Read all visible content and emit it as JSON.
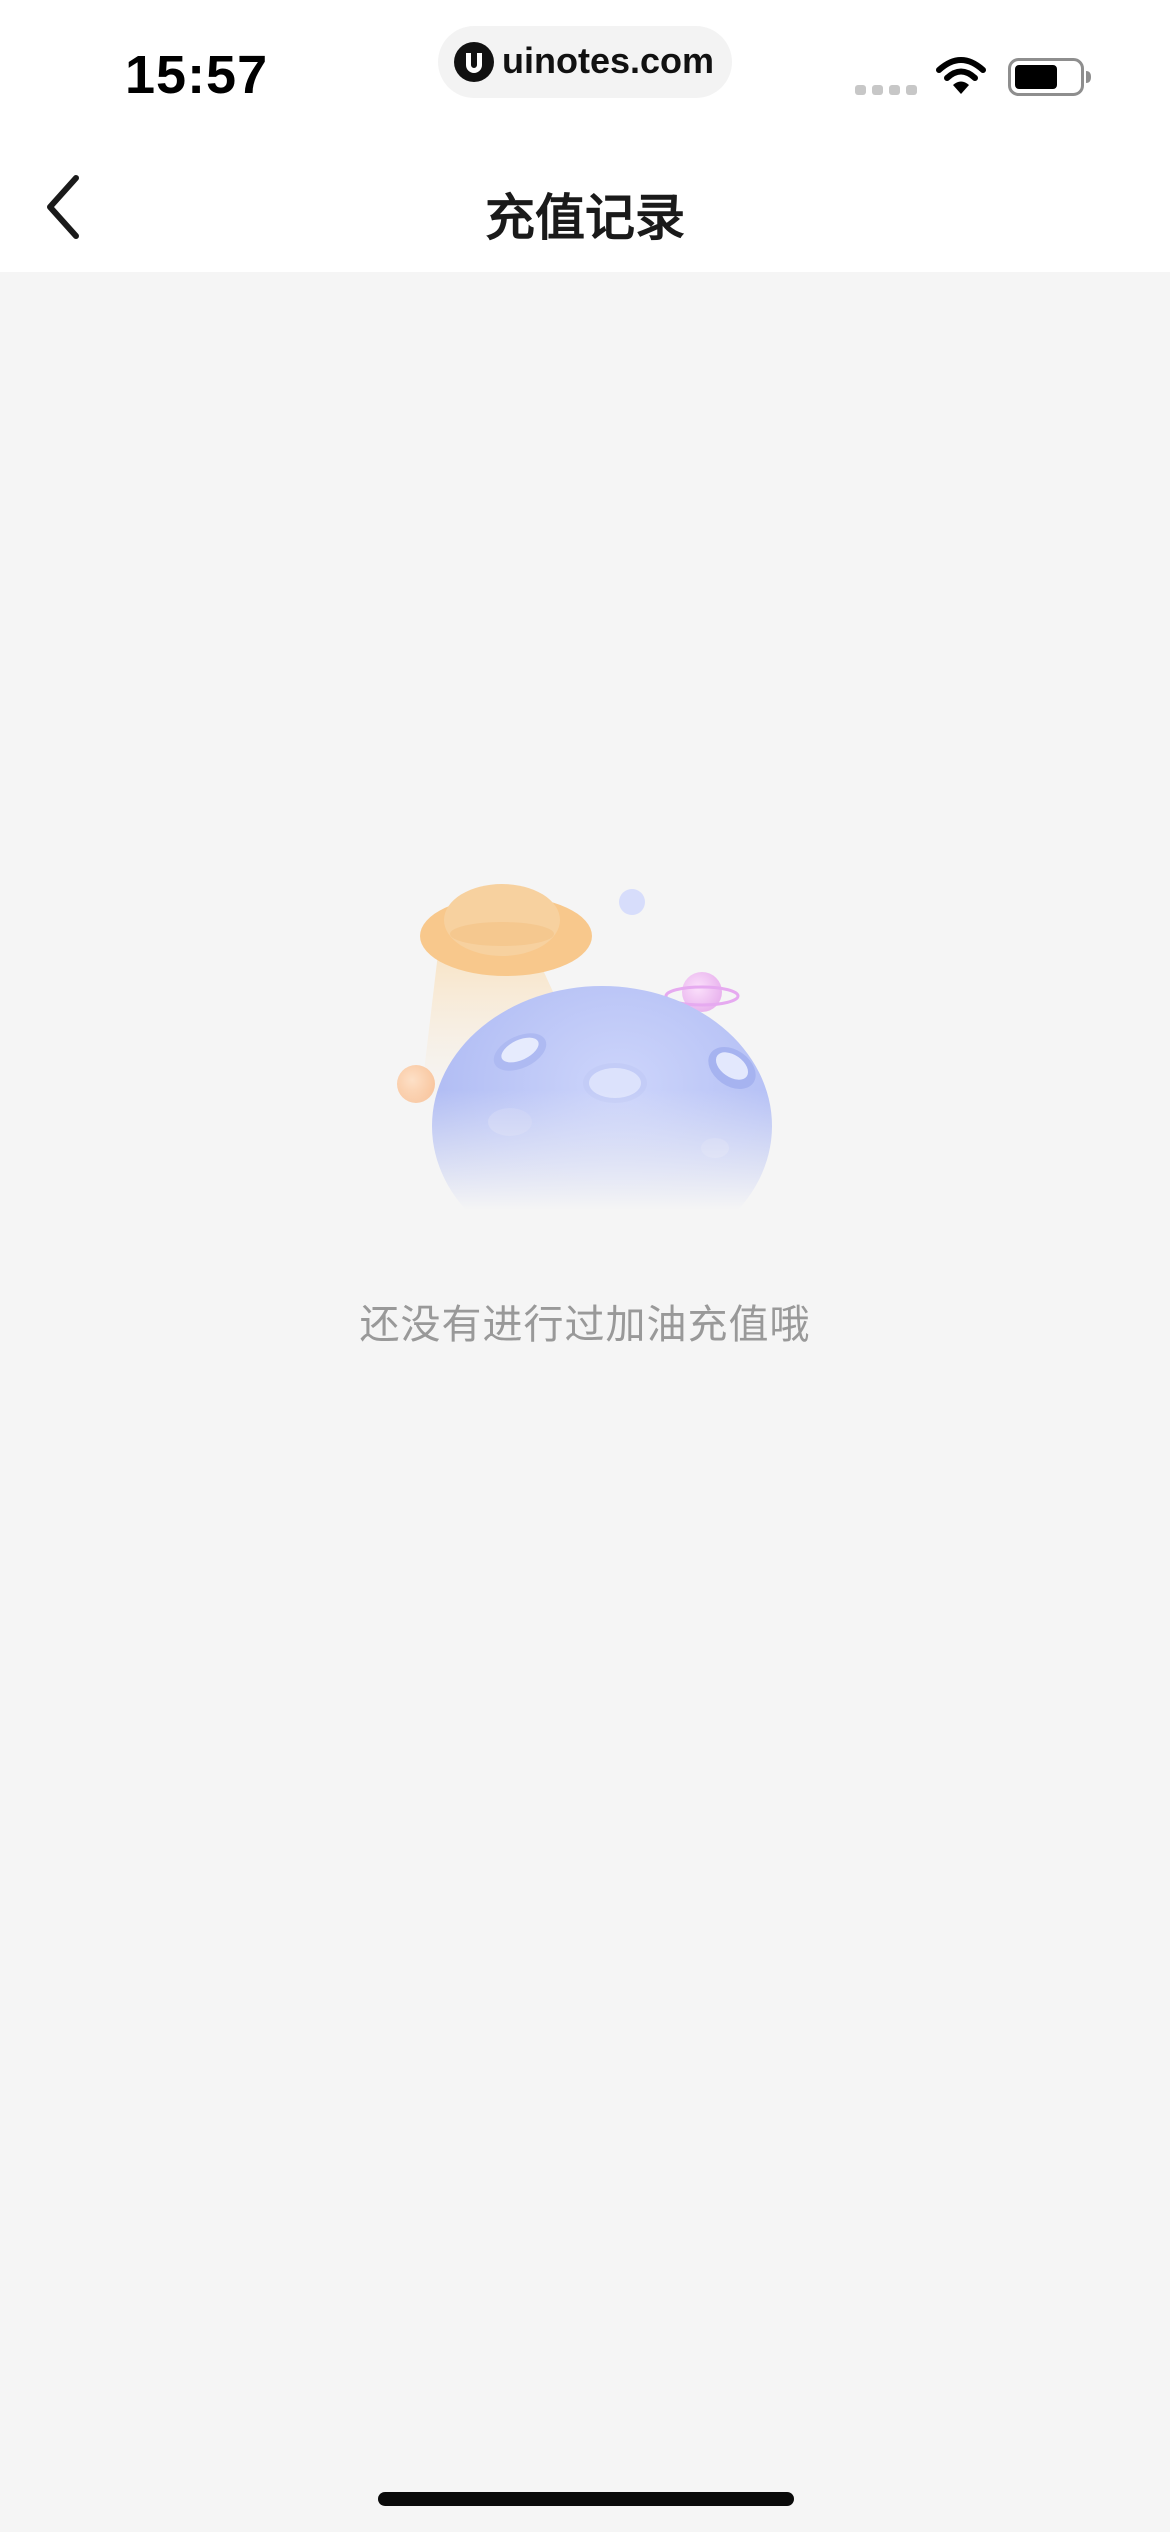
{
  "status_bar": {
    "time": "15:57",
    "url": "uinotes.com"
  },
  "nav": {
    "title": "充值记录",
    "back_icon": "chevron-left-icon"
  },
  "empty_state": {
    "illustration": "ufo-planet-illustration",
    "message": "还没有进行过加油充值哦"
  },
  "colors": {
    "page_background": "#f5f5f5",
    "header_background": "#ffffff",
    "title_text": "#1a1a1a",
    "empty_text": "#999999",
    "ufo": "#f7c78a",
    "planet": "#b9c4f6",
    "ringed_planet": "#efc1ef"
  }
}
